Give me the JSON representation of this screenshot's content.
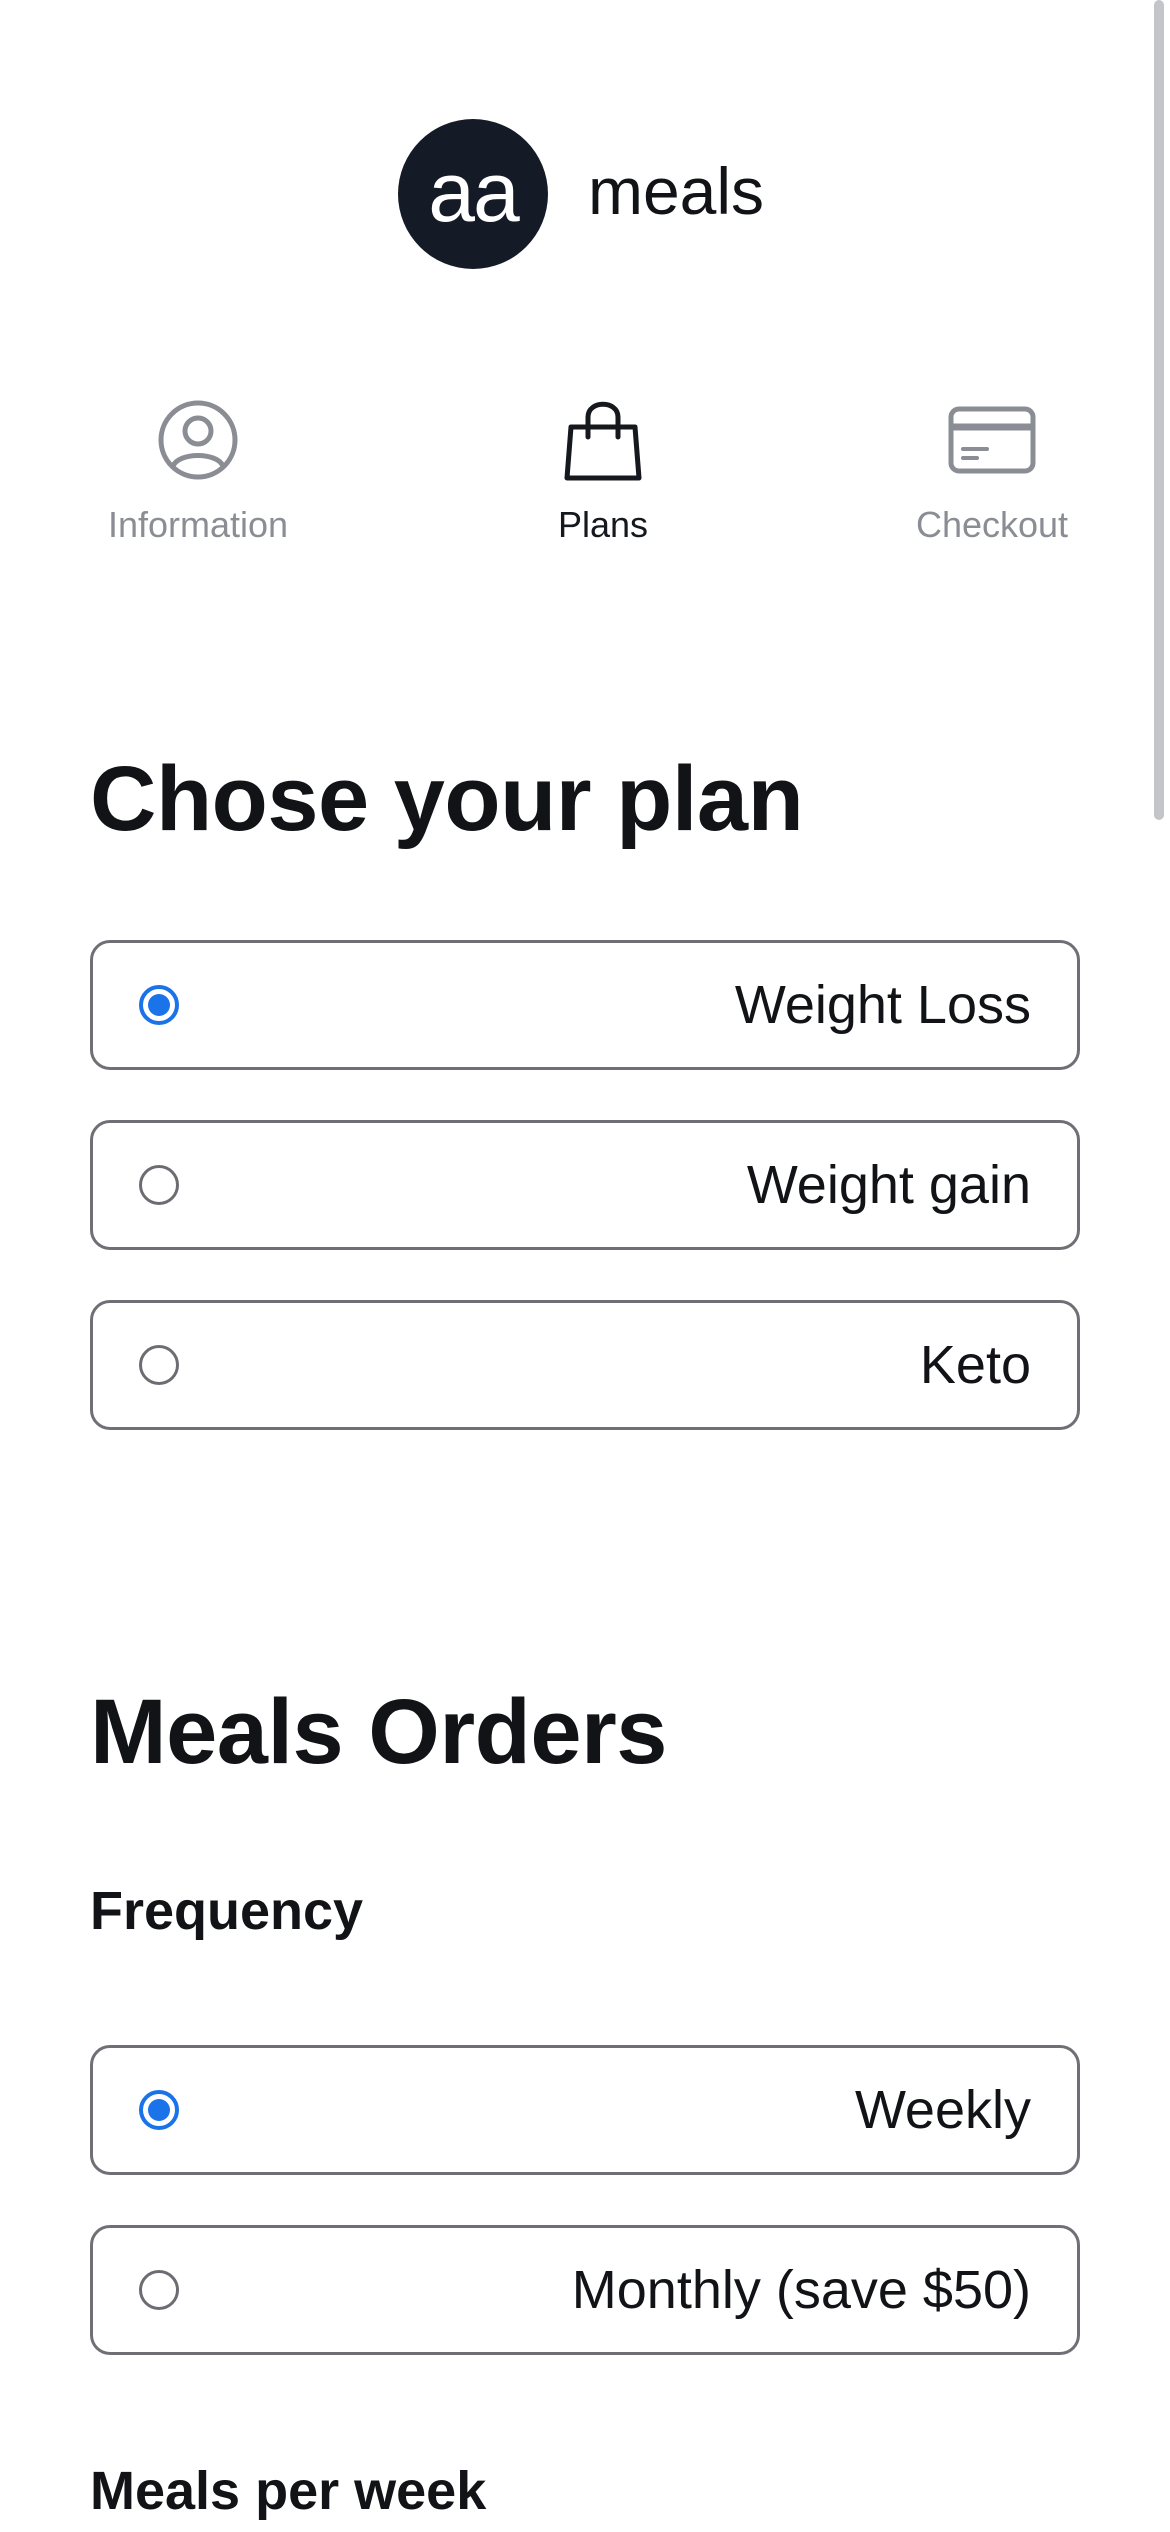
{
  "brand": {
    "mark": "aa",
    "name": "meals"
  },
  "steps": [
    {
      "label": "Information",
      "icon": "user-circle-icon",
      "active": false
    },
    {
      "label": "Plans",
      "icon": "shopping-bag-icon",
      "active": true
    },
    {
      "label": "Checkout",
      "icon": "credit-card-icon",
      "active": false
    }
  ],
  "plan_section": {
    "title": "Chose your plan",
    "options": [
      {
        "label": "Weight Loss",
        "selected": true
      },
      {
        "label": "Weight gain",
        "selected": false
      },
      {
        "label": "Keto",
        "selected": false
      }
    ]
  },
  "orders_section": {
    "title": "Meals Orders",
    "frequency": {
      "label": "Frequency",
      "options": [
        {
          "label": "Weekly",
          "selected": true
        },
        {
          "label": "Monthly (save $50)",
          "selected": false
        }
      ]
    },
    "meals_per_week": {
      "label": "Meals per week"
    }
  },
  "colors": {
    "accent": "#1a73e8",
    "logo_bg": "#151b26",
    "inactive_text": "#8a8d93",
    "border": "#6e7076"
  }
}
